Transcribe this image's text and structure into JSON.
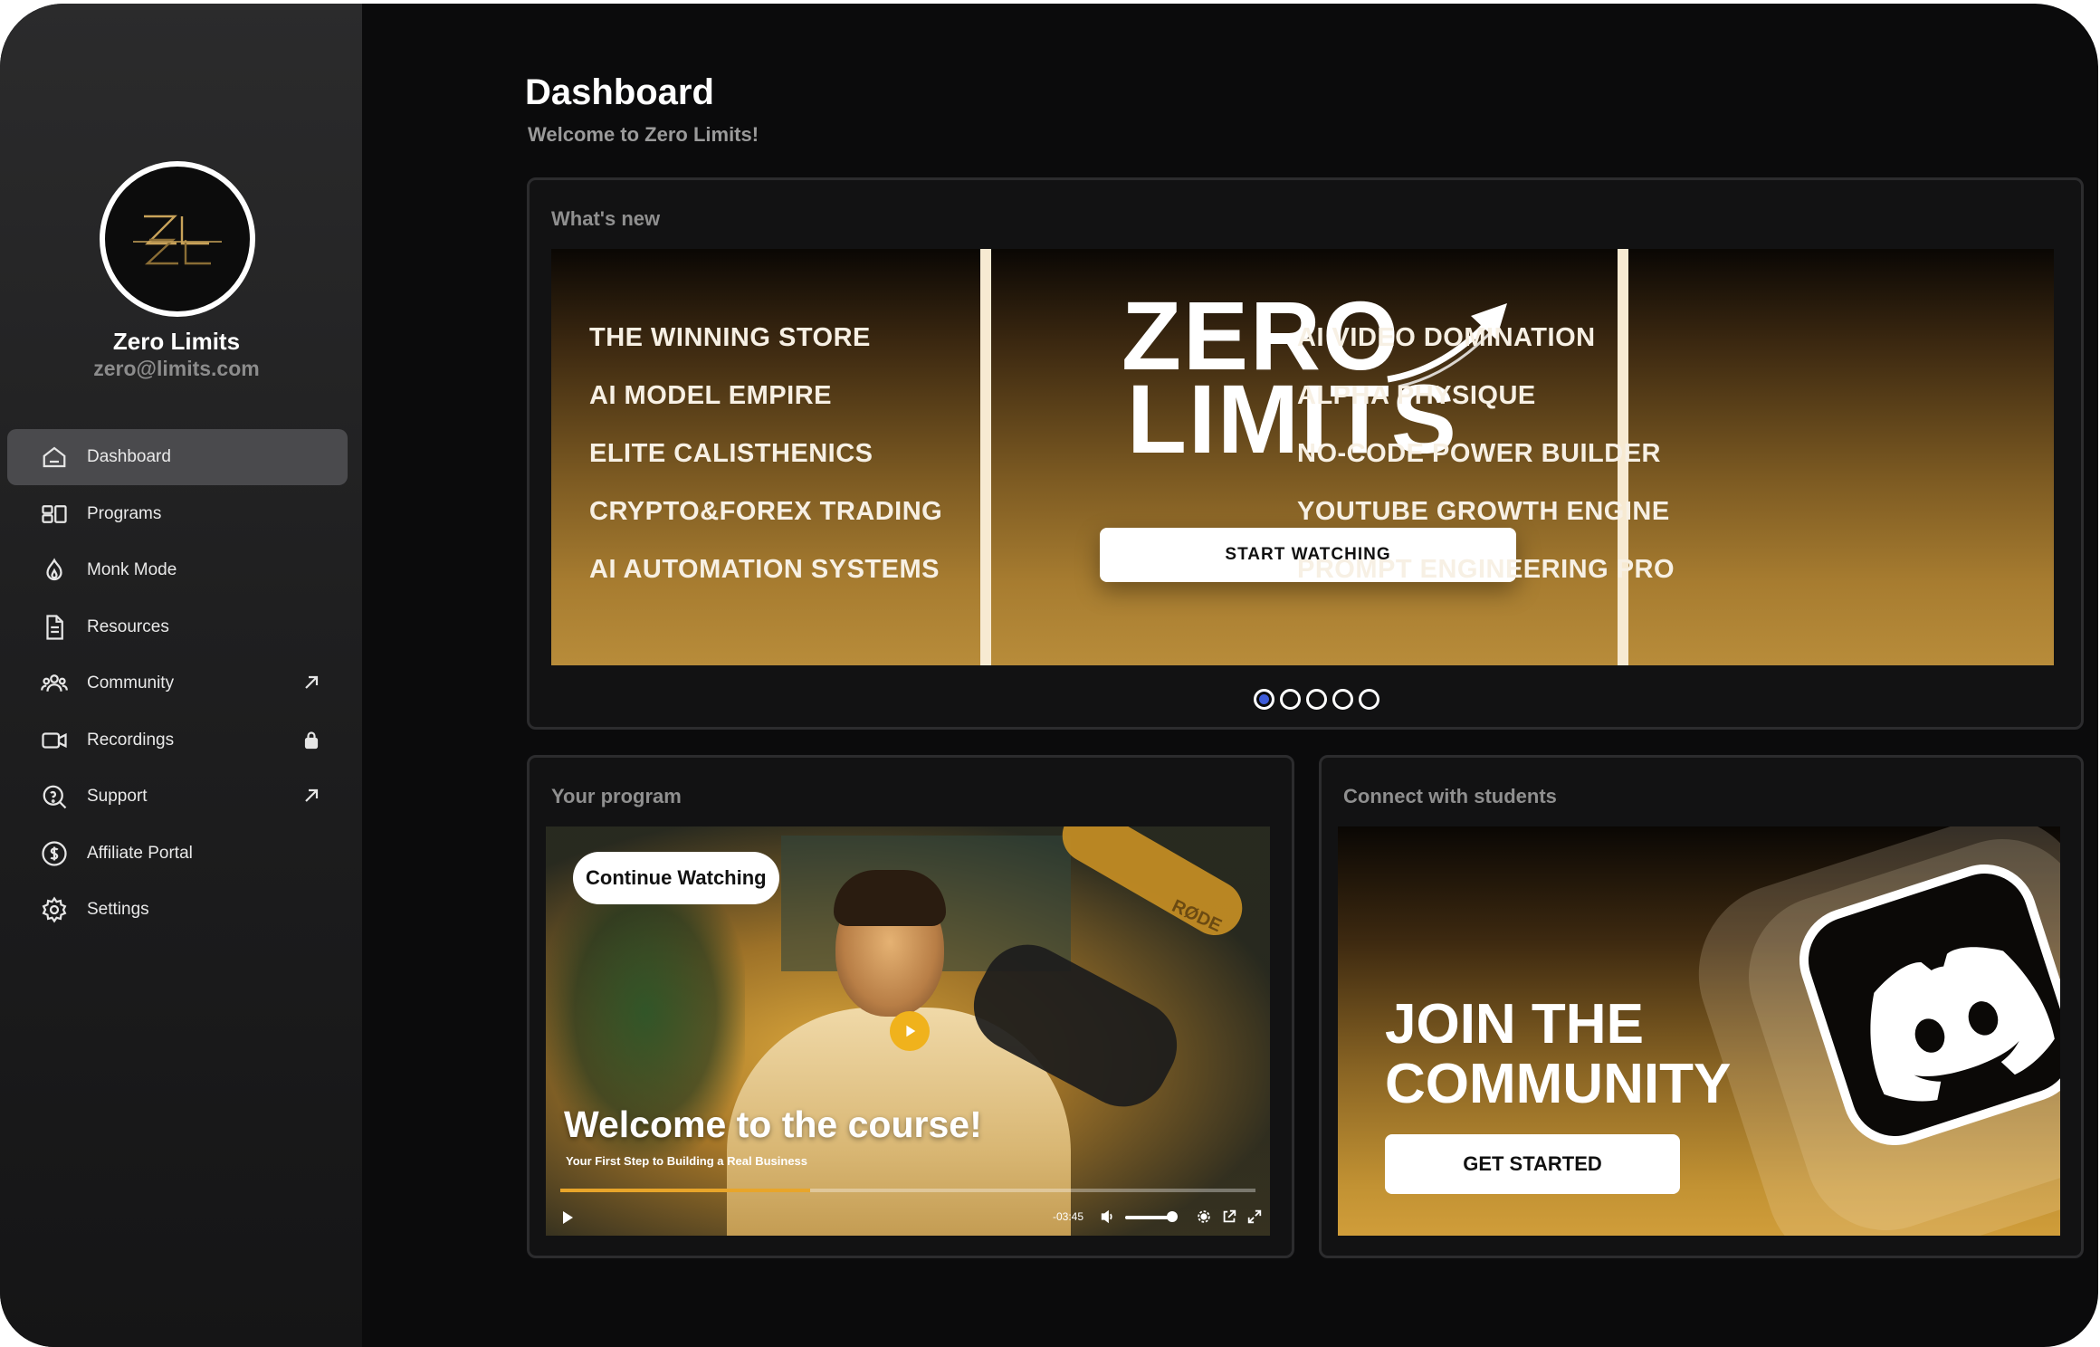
{
  "user": {
    "name": "Zero Limits",
    "email": "zero@limits.com",
    "avatar_monogram": "ZL"
  },
  "sidebar": {
    "items": [
      {
        "label": "Dashboard",
        "icon": "home-icon",
        "active": true
      },
      {
        "label": "Programs",
        "icon": "programs-icon"
      },
      {
        "label": "Monk Mode",
        "icon": "flame-icon"
      },
      {
        "label": "Resources",
        "icon": "document-icon"
      },
      {
        "label": "Community",
        "icon": "users-icon",
        "trail": "external-link-icon"
      },
      {
        "label": "Recordings",
        "icon": "video-icon",
        "trail": "lock-icon"
      },
      {
        "label": "Support",
        "icon": "support-icon",
        "trail": "external-link-icon"
      },
      {
        "label": "Affiliate Portal",
        "icon": "dollar-icon"
      },
      {
        "label": "Settings",
        "icon": "gear-icon"
      }
    ]
  },
  "header": {
    "title": "Dashboard",
    "subtitle": "Welcome to Zero Limits!"
  },
  "whats_new": {
    "title": "What's new",
    "left_programs": [
      "THE WINNING STORE",
      "AI MODEL EMPIRE",
      "ELITE CALISTHENICS",
      "CRYPTO&FOREX TRADING",
      "AI AUTOMATION SYSTEMS"
    ],
    "right_programs": [
      "AI VIDEO DOMINATION",
      "ALPHA PHYSIQUE",
      "NO-CODE POWER BUILDER",
      "YOUTUBE GROWTH ENGINE",
      "PROMPT ENGINEERING PRO"
    ],
    "logo_line1": "ZERO",
    "logo_line2": "LIMITS",
    "cta_label": "START WATCHING",
    "slides_total": 5,
    "active_slide": 1
  },
  "program": {
    "title": "Your program",
    "continue_label": "Continue Watching",
    "video_title": "Welcome to the course!",
    "video_subtitle": "Your First Step to Building a Real Business",
    "brand_mark": "RØDE",
    "time_remaining": "-03:45",
    "progress_fraction": 0.36,
    "accent": "#e8a52a"
  },
  "connect": {
    "title": "Connect with students",
    "headline_line1": "JOIN THE",
    "headline_line2": "COMMUNITY",
    "cta_label": "GET STARTED"
  },
  "colors": {
    "gold": "#b88c3a",
    "active_dot": "#3d5bd9",
    "active_nav": "#4a4a4d"
  }
}
